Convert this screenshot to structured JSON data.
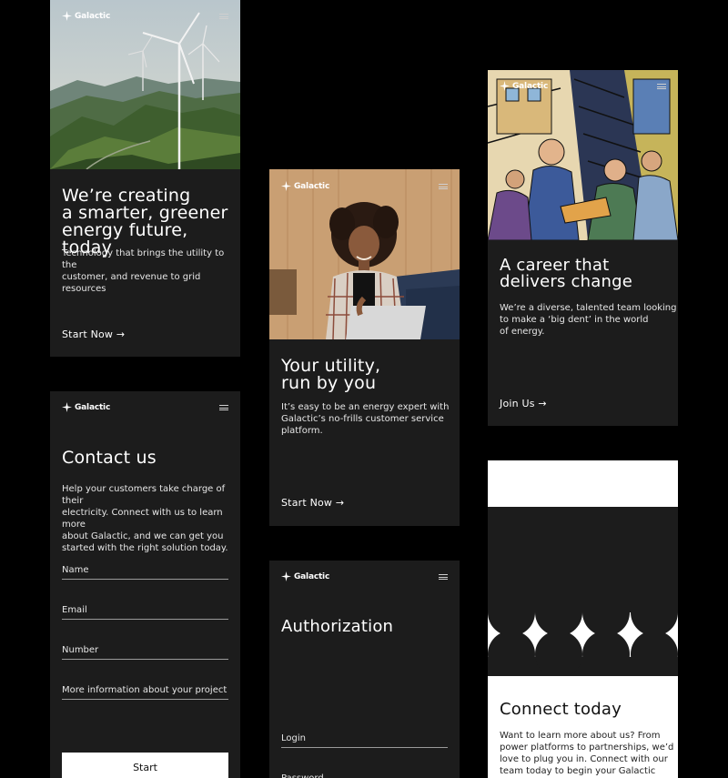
{
  "brand": {
    "name": "Galactic"
  },
  "energy_card": {
    "title_lines": [
      "We’re creating",
      "a smarter, greener",
      "energy future, today"
    ],
    "body_lines": [
      "Technology that brings the utility to the",
      "customer, and revenue to grid resources"
    ],
    "cta": "Start Now →"
  },
  "utility_card": {
    "title_lines": [
      "Your utility,",
      "run by you"
    ],
    "body_lines": [
      "It’s easy to be an energy expert with",
      "Galactic’s no-frills customer service",
      "platform."
    ],
    "cta": "Start Now →"
  },
  "career_card": {
    "title_lines": [
      "A career that",
      "delivers change"
    ],
    "body_lines": [
      "We’re a diverse, talented team looking",
      "to make a ‘big dent’ in the world",
      "of energy."
    ],
    "cta": "Join Us →"
  },
  "contact_card": {
    "title": "Contact us",
    "body_lines": [
      "Help your customers take charge of their",
      "electricity. Connect with us to learn more",
      "about Galactic, and we can get you",
      "started with the right solution today."
    ],
    "fields": {
      "name": "Name",
      "email": "Email",
      "number": "Number",
      "info": "More information about your project"
    },
    "submit": "Start"
  },
  "auth_card": {
    "title": "Authorization",
    "login": "Login",
    "password": "Password"
  },
  "connect_card": {
    "title": "Connect today",
    "body_lines": [
      "Want to learn more about us? From",
      "power platforms to partnerships, we’d",
      "love to plug you in. Connect with our",
      "team today to begin your Galactic"
    ]
  },
  "icons": {
    "brand": "galactic-logo-icon",
    "menu": "hamburger-menu-icon"
  },
  "colors": {
    "background": "#000000",
    "card": "#1c1c1c",
    "text": "#ffffff"
  }
}
